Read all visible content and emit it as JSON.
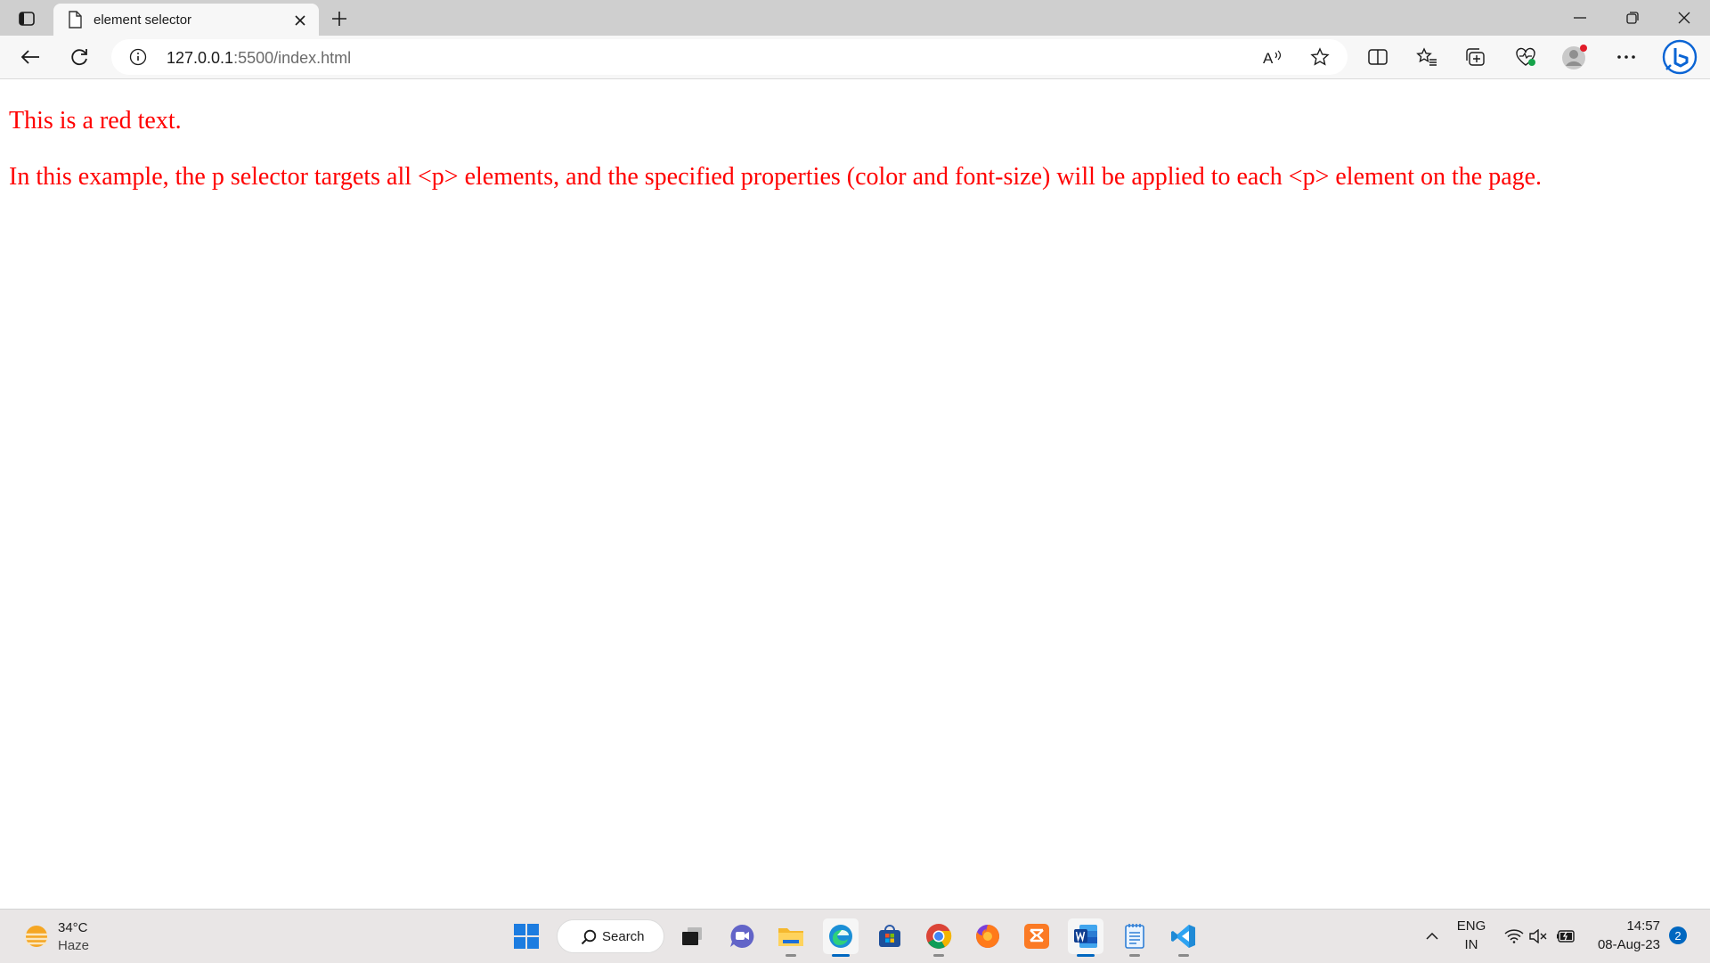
{
  "browser": {
    "tab": {
      "title": "element selector"
    },
    "address": {
      "url_host": "127.0.0.1",
      "url_rest": ":5500/index.html"
    },
    "icons": [
      "tab-actions-icon",
      "page-icon",
      "close-icon",
      "plus-icon",
      "minimize-icon",
      "restore-icon",
      "close-window-icon",
      "back-arrow-icon",
      "refresh-icon",
      "info-icon",
      "read-aloud-icon",
      "star-icon",
      "split-screen-icon",
      "favorites-icon",
      "collections-icon",
      "browser-essentials-icon",
      "profile-icon",
      "more-icon",
      "bing-icon"
    ]
  },
  "page": {
    "para1": "This is a red text.",
    "para2": "In this example, the p selector targets all <p> elements, and the specified properties (color and font-size) will be applied to each <p> element on the page.",
    "text_color": "#ff0000"
  },
  "taskbar": {
    "weather": {
      "temp": "34°C",
      "desc": "Haze"
    },
    "search_label": "Search",
    "apps": [
      "start-icon",
      "search-icon",
      "task-view-icon",
      "teams-chat-icon",
      "file-explorer-icon",
      "edge-icon",
      "store-icon",
      "chrome-icon",
      "firefox-icon",
      "xampp-icon",
      "word-icon",
      "notepad-icon",
      "vscode-icon"
    ],
    "tray": {
      "lang": "ENG",
      "region": "IN",
      "time": "14:57",
      "date": "08-Aug-23",
      "notifications": "2"
    }
  }
}
